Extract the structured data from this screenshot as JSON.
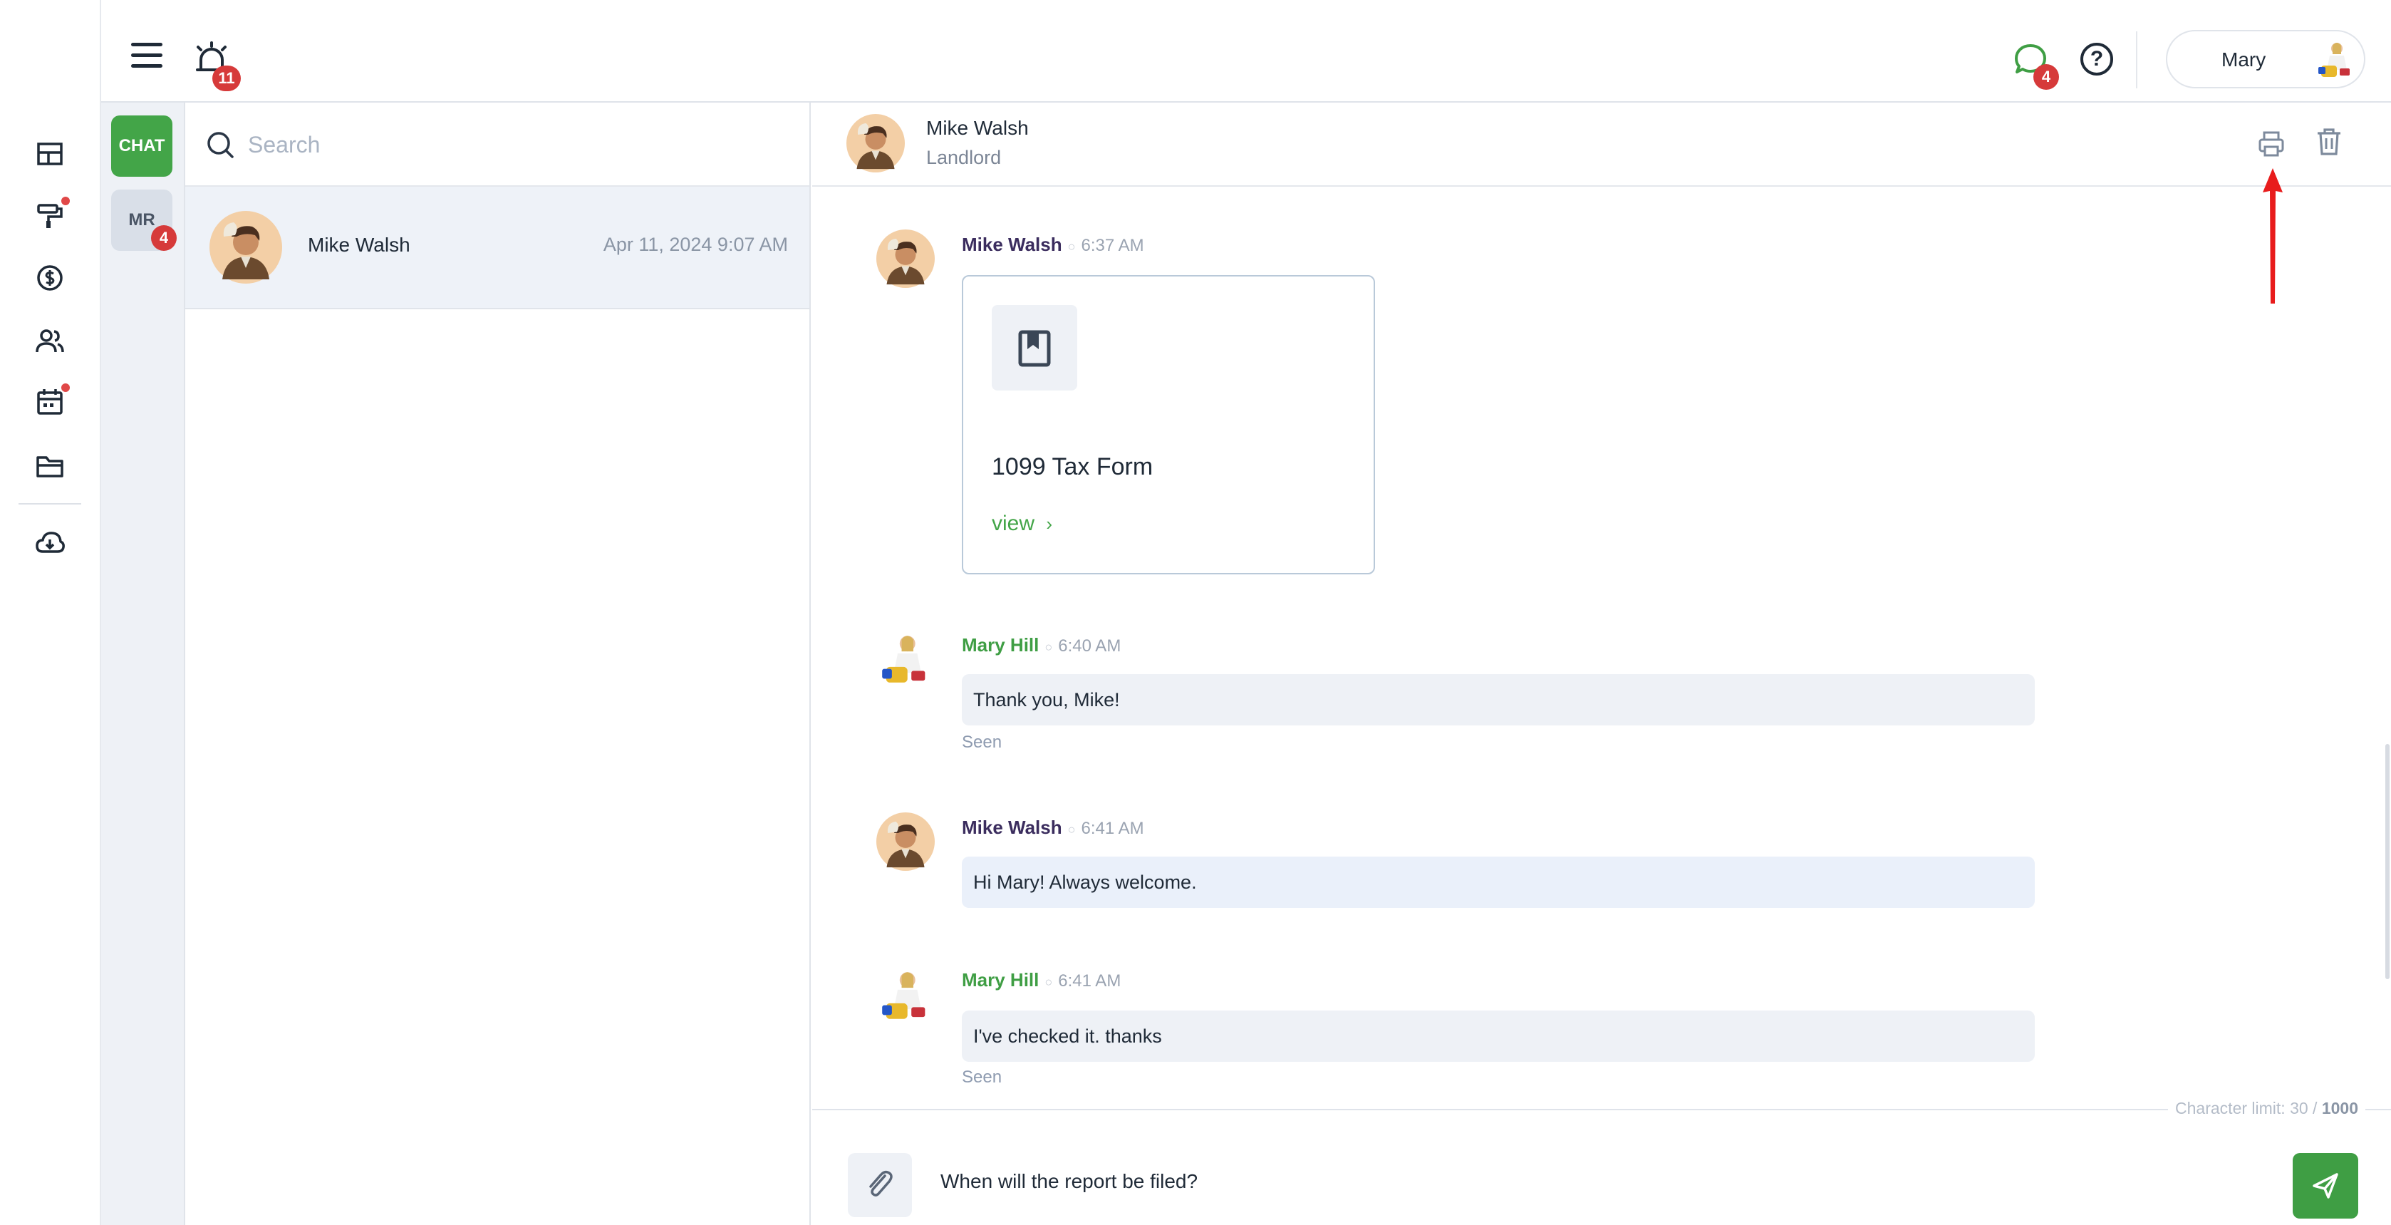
{
  "topbar": {
    "alarm_badge": "11",
    "chat_badge": "4",
    "user_name": "Mary"
  },
  "channels": {
    "chat_tab_label": "CHAT",
    "mr_tab_label": "MR",
    "mr_badge": "4"
  },
  "search": {
    "placeholder": "Search"
  },
  "conversations": [
    {
      "name": "Mike Walsh",
      "timestamp": "Apr 11, 2024 9:07 AM"
    }
  ],
  "chat_header": {
    "name": "Mike Walsh",
    "role": "Landlord"
  },
  "messages": [
    {
      "sender": "Mike Walsh",
      "time": "6:37 AM",
      "document_title": "1099 Tax Form",
      "document_link": "view"
    },
    {
      "sender": "Mary Hill",
      "time": "6:40 AM",
      "text": "Thank you, Mike!",
      "status": "Seen"
    },
    {
      "sender": "Mike Walsh",
      "time": "6:41 AM",
      "text": "Hi Mary! Always welcome."
    },
    {
      "sender": "Mary Hill",
      "time": "6:41 AM",
      "text": "I've checked it. thanks",
      "status": "Seen"
    }
  ],
  "composer": {
    "limit_label": "Character limit: 30 /",
    "limit_max": "1000",
    "text": "When will the report be filed?"
  },
  "colors": {
    "accent_green": "#43a548",
    "badge_red": "#d63a3a",
    "annotation_red": "#e81c1c"
  }
}
